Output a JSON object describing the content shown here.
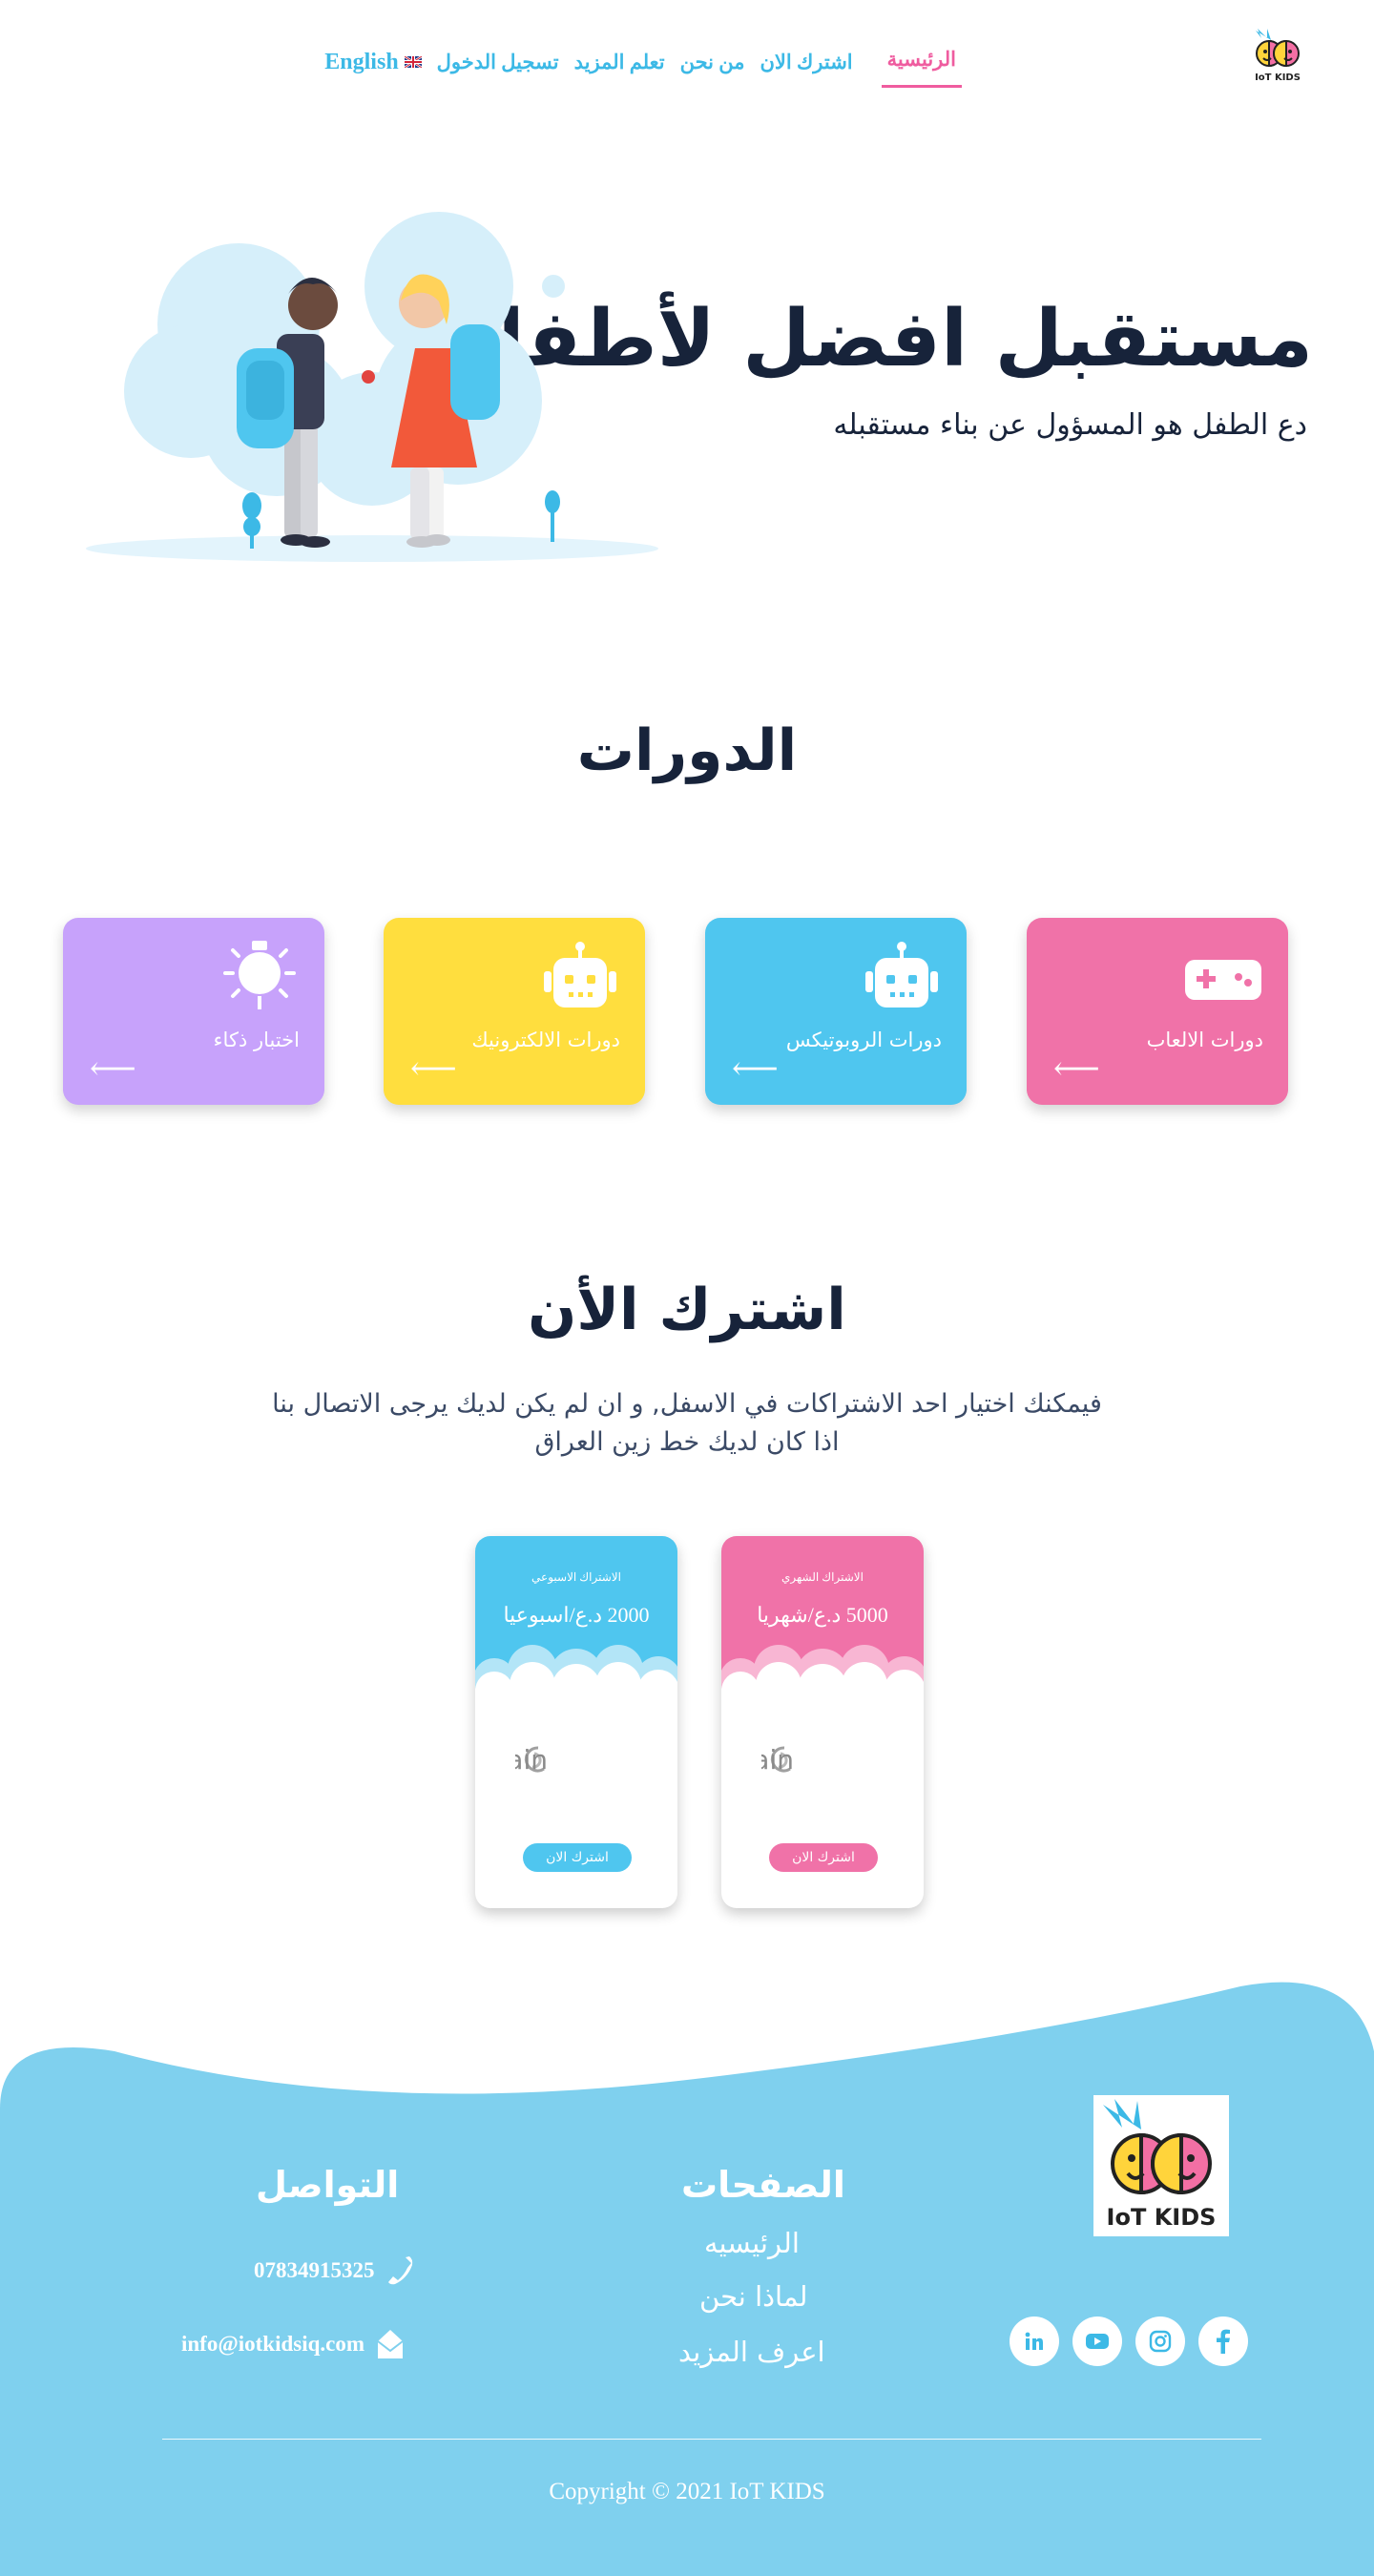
{
  "nav": {
    "home": "الرئيسية",
    "subscribe": "اشترك الان",
    "about": "من نحن",
    "learn_more": "تعلم المزيد",
    "login": "تسجيل الدخول",
    "language": "English",
    "brand": "IoT KIDS"
  },
  "hero": {
    "title": "مستقبل افضل  لأطفالك",
    "subtitle": "دع الطفل هو المسؤول عن بناء مستقبله"
  },
  "courses": {
    "title": "الدورات",
    "items": [
      {
        "label": "دورات الالعاب",
        "icon": "gamepad-icon",
        "color": "#f072a8"
      },
      {
        "label": "دورات الروبوتيكس",
        "icon": "robot-icon",
        "color": "#4fc6ef"
      },
      {
        "label": "دورات الالكترونيك",
        "icon": "robot-icon",
        "color": "#ffde3e"
      },
      {
        "label": "اختبار ذكاء",
        "icon": "lightbulb-icon",
        "color": "#c7a2fb"
      }
    ],
    "arrow": "⟵"
  },
  "subscribe": {
    "title": "اشترك الأن",
    "desc_line1": "فيمكنك اختيار احد الاشتراكات في الاسفل, و ان لم يكن لديك يرجى الاتصال بنا",
    "desc_line2": "اذا كان لديك خط زين العراق",
    "plans": [
      {
        "name": "الاشتراك الشهري",
        "price": "5000 د.ع/شهريا",
        "button": "اشترك الان",
        "color": "#f072a8",
        "provider": "zain"
      },
      {
        "name": "الاشتراك الاسبوعي",
        "price": "2000 د.ع/اسبوعيا",
        "button": "اشترك الان",
        "color": "#4fc6ef",
        "provider": "zain"
      }
    ]
  },
  "footer": {
    "brand": "IoT KIDS",
    "pages_title": "الصفحات",
    "pages": [
      "الرئيسيه",
      "لماذا نحن",
      "اعرف المزيد"
    ],
    "contact_title": "التواصل",
    "phone": "07834915325",
    "email": "info@iotkidsiq.com",
    "social": [
      "facebook-icon",
      "instagram-icon",
      "youtube-icon",
      "linkedin-icon"
    ],
    "copyright": "Copyright © 2021 IoT KIDS",
    "bg_color": "#7fd0ee"
  }
}
